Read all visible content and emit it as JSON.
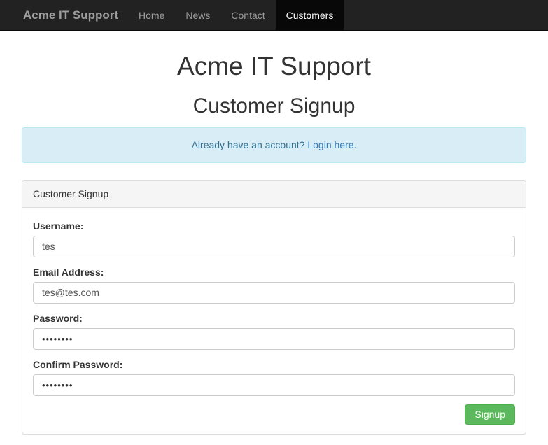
{
  "navbar": {
    "brand": "Acme IT Support",
    "items": [
      {
        "label": "Home",
        "active": false
      },
      {
        "label": "News",
        "active": false
      },
      {
        "label": "Contact",
        "active": false
      },
      {
        "label": "Customers",
        "active": true
      }
    ]
  },
  "page": {
    "title": "Acme IT Support",
    "subtitle": "Customer Signup"
  },
  "alert": {
    "text": "Already have an account? ",
    "link_label": "Login here."
  },
  "panel": {
    "heading": "Customer Signup"
  },
  "form": {
    "username": {
      "label": "Username:",
      "value": "tes"
    },
    "email": {
      "label": "Email Address:",
      "value": "tes@tes.com"
    },
    "password": {
      "label": "Password:",
      "value": "••••••••"
    },
    "confirm_password": {
      "label": "Confirm Password:",
      "value": "••••••••"
    },
    "submit_label": "Signup"
  },
  "colors": {
    "navbar_bg": "#222222",
    "navbar_active_bg": "#080808",
    "navbar_text": "#9d9d9d",
    "heading_text": "#333333",
    "alert_bg": "#d9edf7",
    "alert_border": "#bce8f1",
    "alert_text": "#31708f",
    "link": "#337ab7",
    "panel_heading_bg": "#f5f5f5",
    "panel_border": "#dddddd",
    "button_bg": "#5cb85c",
    "button_border": "#4cae4c",
    "button_text": "#ffffff"
  }
}
